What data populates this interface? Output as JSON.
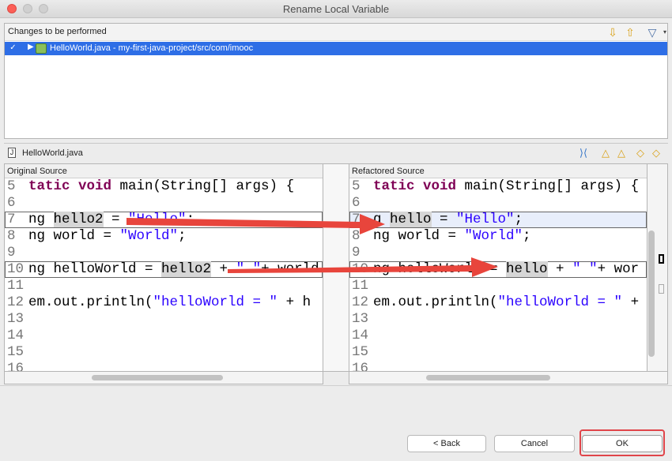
{
  "window": {
    "title": "Rename Local Variable"
  },
  "changes": {
    "label": "Changes to be performed",
    "item": {
      "checked": true,
      "text": "HelloWorld.java - my-first-java-project/src/com/imooc"
    }
  },
  "file": {
    "name": "HelloWorld.java"
  },
  "original": {
    "header": "Original Source",
    "lines": [
      {
        "num": "5",
        "parts": [
          {
            "t": "tatic void ",
            "c": "kw"
          },
          {
            "t": "main(String[] args) {",
            "c": ""
          }
        ]
      },
      {
        "num": "6",
        "parts": []
      },
      {
        "num": "7",
        "parts": [
          {
            "t": "ng ",
            "c": ""
          },
          {
            "t": "hello2",
            "c": "hl"
          },
          {
            "t": " = ",
            "c": ""
          },
          {
            "t": "\"Hello\"",
            "c": "str"
          },
          {
            "t": ";",
            "c": ""
          }
        ]
      },
      {
        "num": "8",
        "parts": [
          {
            "t": "ng world = ",
            "c": ""
          },
          {
            "t": "\"World\"",
            "c": "str"
          },
          {
            "t": ";",
            "c": ""
          }
        ]
      },
      {
        "num": "9",
        "parts": []
      },
      {
        "num": "10",
        "parts": [
          {
            "t": "ng helloWorld = ",
            "c": ""
          },
          {
            "t": "hello2",
            "c": "hl"
          },
          {
            "t": " + ",
            "c": ""
          },
          {
            "t": "\" \"",
            "c": "str"
          },
          {
            "t": "+ world",
            "c": ""
          }
        ]
      },
      {
        "num": "11",
        "parts": []
      },
      {
        "num": "12",
        "parts": [
          {
            "t": "em.out.println(",
            "c": ""
          },
          {
            "t": "\"helloWorld = \"",
            "c": "str"
          },
          {
            "t": " + h",
            "c": ""
          }
        ]
      },
      {
        "num": "13",
        "parts": []
      },
      {
        "num": "14",
        "parts": []
      },
      {
        "num": "15",
        "parts": []
      },
      {
        "num": "16",
        "parts": []
      }
    ]
  },
  "refactored": {
    "header": "Refactored Source",
    "lines": [
      {
        "num": "5",
        "parts": [
          {
            "t": "tatic void ",
            "c": "kw"
          },
          {
            "t": "main(String[] args) {",
            "c": ""
          }
        ]
      },
      {
        "num": "6",
        "parts": []
      },
      {
        "num": "7",
        "parts": [
          {
            "t": "g ",
            "c": ""
          },
          {
            "t": "hello",
            "c": "hl"
          },
          {
            "t": " = ",
            "c": ""
          },
          {
            "t": "\"Hello\"",
            "c": "str"
          },
          {
            "t": ";",
            "c": ""
          }
        ]
      },
      {
        "num": "8",
        "parts": [
          {
            "t": "ng world = ",
            "c": ""
          },
          {
            "t": "\"World\"",
            "c": "str"
          },
          {
            "t": ";",
            "c": ""
          }
        ]
      },
      {
        "num": "9",
        "parts": []
      },
      {
        "num": "10",
        "parts": [
          {
            "t": "ng helloWorld = ",
            "c": ""
          },
          {
            "t": "hello",
            "c": "hl"
          },
          {
            "t": " + ",
            "c": ""
          },
          {
            "t": "\" \"",
            "c": "str"
          },
          {
            "t": "+ wor",
            "c": ""
          }
        ]
      },
      {
        "num": "11",
        "parts": []
      },
      {
        "num": "12",
        "parts": [
          {
            "t": "em.out.println(",
            "c": ""
          },
          {
            "t": "\"helloWorld = \"",
            "c": "str"
          },
          {
            "t": " + ",
            "c": ""
          }
        ]
      },
      {
        "num": "13",
        "parts": []
      },
      {
        "num": "14",
        "parts": []
      },
      {
        "num": "15",
        "parts": []
      },
      {
        "num": "16",
        "parts": []
      }
    ]
  },
  "buttons": {
    "back": "< Back",
    "cancel": "Cancel",
    "ok": "OK"
  },
  "colors": {
    "annotation": "#e0454a",
    "selection": "#2e6ee6"
  }
}
